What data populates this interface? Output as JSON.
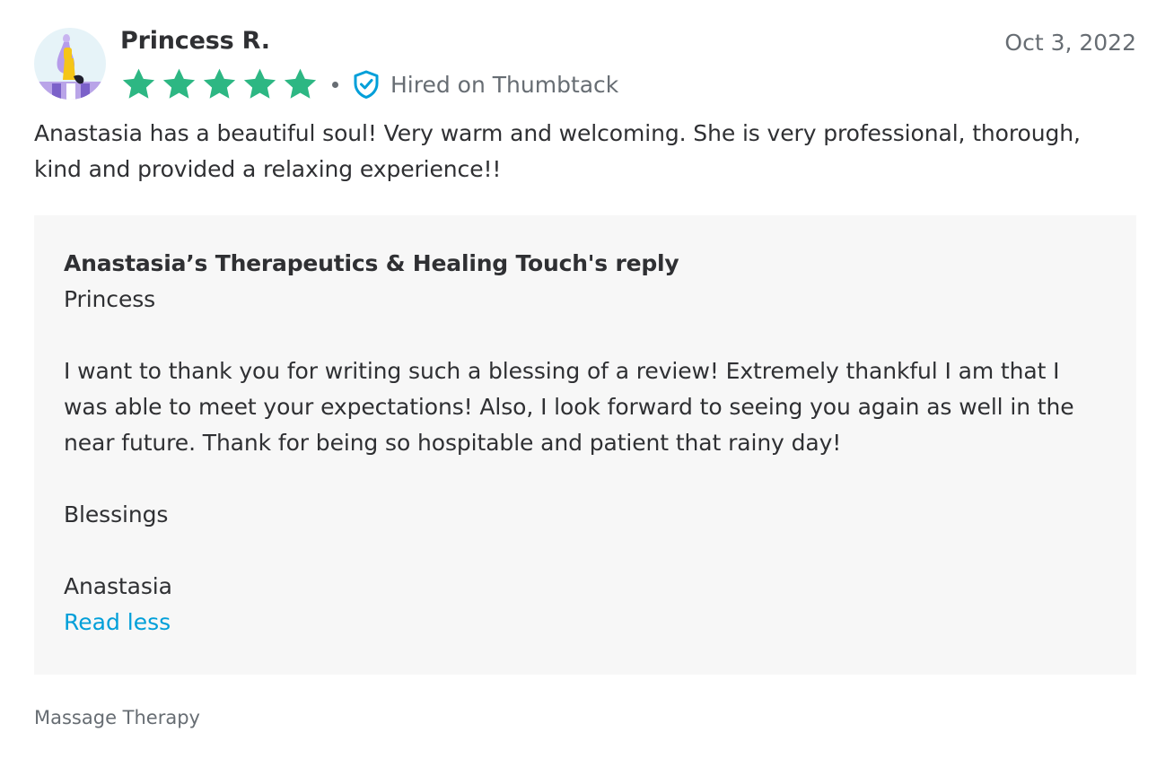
{
  "review": {
    "avatar_icon": "user-avatar-illustration",
    "reviewer_name": "Princess R.",
    "date": "Oct 3, 2022",
    "rating": 5,
    "max_rating": 5,
    "star_color": "#2db783",
    "verified_icon": "shield-check-icon",
    "verified_color": "#009fd9",
    "hired_label": "Hired on Thumbtack",
    "text": "Anastasia has a beautiful soul! Very warm and welcoming. She is very professional, thorough, kind and provided a relaxing experience!!"
  },
  "reply": {
    "title": "Anastasia’s Therapeutics & Healing Touch's reply",
    "greeting": "Princess",
    "body": "I want to thank you for writing such a blessing of a review! Extremely thankful I am that I was able to meet your expectations! Also, I look forward to seeing you again as well in the near future. Thank for being so hospitable and patient that rainy day!",
    "closing": "Blessings",
    "signature": "Anastasia",
    "read_less_label": "Read less",
    "link_color": "#009fd9"
  },
  "category": "Massage Therapy"
}
